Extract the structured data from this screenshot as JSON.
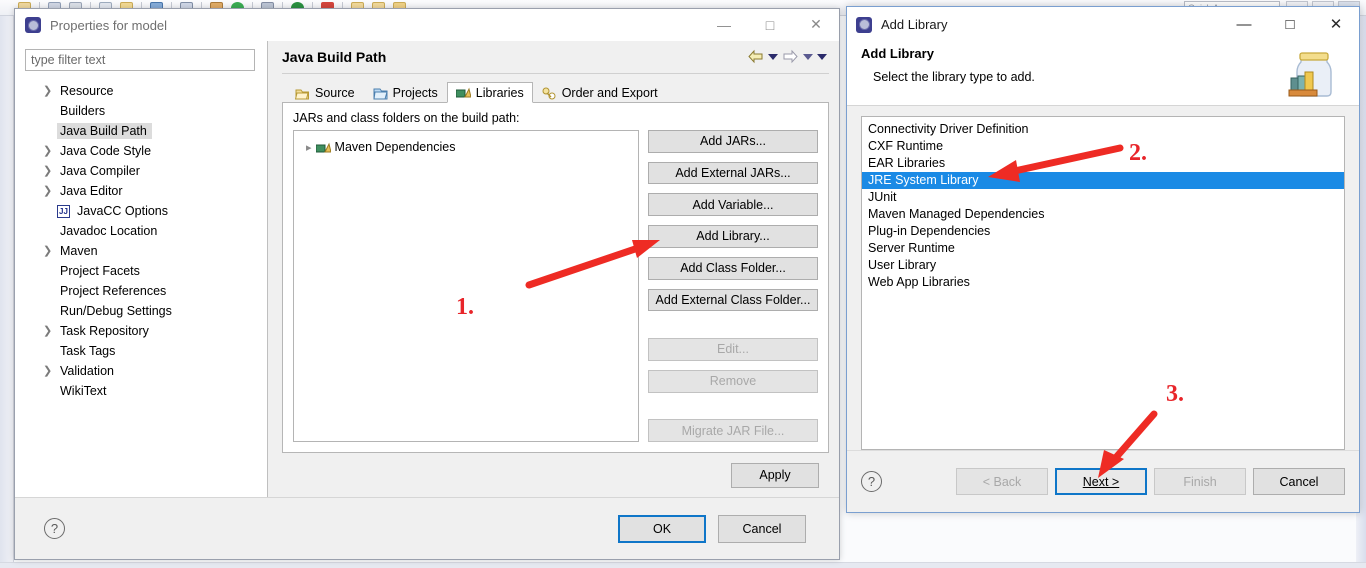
{
  "eclipse": {
    "quick_access_placeholder": "Quick Access",
    "toolbar_icons": [
      "new-icon",
      "save-icon",
      "print-icon",
      "open-icon",
      "folder-icon",
      "search-icon",
      "package-icon",
      "run-icon",
      "debug-icon",
      "stop-icon",
      "perspective-icon"
    ]
  },
  "properties_window": {
    "title": "Properties for model",
    "title_icon": "eclipse-gear-icon",
    "minimize_label": "—",
    "maximize_label": "□",
    "close_label": "✕",
    "filter": {
      "placeholder": "type filter text",
      "value": ""
    },
    "tree": [
      {
        "label": "Resource",
        "expandable": true,
        "selected": false,
        "icon": ""
      },
      {
        "label": "Builders",
        "expandable": false,
        "selected": false,
        "icon": ""
      },
      {
        "label": "Java Build Path",
        "expandable": false,
        "selected": true,
        "icon": ""
      },
      {
        "label": "Java Code Style",
        "expandable": true,
        "selected": false,
        "icon": ""
      },
      {
        "label": "Java Compiler",
        "expandable": true,
        "selected": false,
        "icon": ""
      },
      {
        "label": "Java Editor",
        "expandable": true,
        "selected": false,
        "icon": ""
      },
      {
        "label": "JavaCC Options",
        "expandable": false,
        "selected": false,
        "icon": "javacc-icon"
      },
      {
        "label": "Javadoc Location",
        "expandable": false,
        "selected": false,
        "icon": ""
      },
      {
        "label": "Maven",
        "expandable": true,
        "selected": false,
        "icon": ""
      },
      {
        "label": "Project Facets",
        "expandable": false,
        "selected": false,
        "icon": ""
      },
      {
        "label": "Project References",
        "expandable": false,
        "selected": false,
        "icon": ""
      },
      {
        "label": "Run/Debug Settings",
        "expandable": false,
        "selected": false,
        "icon": ""
      },
      {
        "label": "Task Repository",
        "expandable": true,
        "selected": false,
        "icon": ""
      },
      {
        "label": "Task Tags",
        "expandable": false,
        "selected": false,
        "icon": ""
      },
      {
        "label": "Validation",
        "expandable": true,
        "selected": false,
        "icon": ""
      },
      {
        "label": "WikiText",
        "expandable": false,
        "selected": false,
        "icon": ""
      }
    ],
    "page_title": "Java Build Path",
    "nav": {
      "back_icon": "back-arrow-icon",
      "forward_icon": "forward-arrow-icon",
      "menu_icon": "view-menu-icon"
    },
    "tabs": [
      {
        "label": "Source",
        "icon": "source-folder-icon",
        "active": false
      },
      {
        "label": "Projects",
        "icon": "projects-icon",
        "active": false
      },
      {
        "label": "Libraries",
        "icon": "libraries-icon",
        "active": true
      },
      {
        "label": "Order and Export",
        "icon": "order-export-icon",
        "active": false
      }
    ],
    "jars_label": "JARs and class folders on the build path:",
    "tree_entries": [
      {
        "label": "Maven Dependencies",
        "icon": "libraries-icon",
        "expandable": true
      }
    ],
    "buttons": [
      {
        "label": "Add JARs...",
        "enabled": true
      },
      {
        "label": "Add External JARs...",
        "enabled": true
      },
      {
        "label": "Add Variable...",
        "enabled": true
      },
      {
        "label": "Add Library...",
        "enabled": true
      },
      {
        "label": "Add Class Folder...",
        "enabled": true
      },
      {
        "label": "Add External Class Folder...",
        "enabled": true
      },
      {
        "label": "Edit...",
        "enabled": false
      },
      {
        "label": "Remove",
        "enabled": false
      },
      {
        "label": "Migrate JAR File...",
        "enabled": false
      }
    ],
    "apply_label": "Apply",
    "help_label": "?",
    "ok_label": "OK",
    "cancel_label": "Cancel"
  },
  "add_library_dialog": {
    "title": "Add Library",
    "title_icon": "eclipse-gear-icon",
    "minimize_label": "—",
    "maximize_label": "□",
    "close_label": "✕",
    "header_title": "Add Library",
    "header_subtitle": "Select the library type to add.",
    "header_icon": "jar-books-icon",
    "list": [
      {
        "label": "Connectivity Driver Definition",
        "selected": false
      },
      {
        "label": "CXF Runtime",
        "selected": false
      },
      {
        "label": "EAR Libraries",
        "selected": false
      },
      {
        "label": "JRE System Library",
        "selected": true
      },
      {
        "label": "JUnit",
        "selected": false
      },
      {
        "label": "Maven Managed Dependencies",
        "selected": false
      },
      {
        "label": "Plug-in Dependencies",
        "selected": false
      },
      {
        "label": "Server Runtime",
        "selected": false
      },
      {
        "label": "User Library",
        "selected": false
      },
      {
        "label": "Web App Libraries",
        "selected": false
      }
    ],
    "help_label": "?",
    "back_label": "< Back",
    "next_label": "Next >",
    "finish_label": "Finish",
    "cancel_label": "Cancel"
  },
  "annotations": {
    "color": "#e8252a",
    "markers": [
      {
        "number": "1.",
        "target": "Add Library... button"
      },
      {
        "number": "2.",
        "target": "JRE System Library list item"
      },
      {
        "number": "3.",
        "target": "Next > button"
      }
    ]
  }
}
